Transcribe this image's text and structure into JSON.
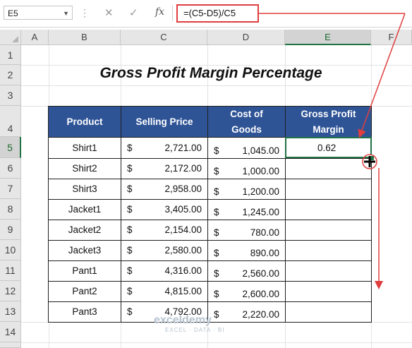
{
  "namebox": {
    "value": "E5"
  },
  "formula_bar": {
    "cancel_icon": "✕",
    "enter_icon": "✓",
    "fx_label": "fx",
    "formula": "=(C5-D5)/C5"
  },
  "columns": [
    "A",
    "B",
    "C",
    "D",
    "E",
    "F"
  ],
  "rows": [
    "1",
    "2",
    "3",
    "4",
    "5",
    "6",
    "7",
    "8",
    "9",
    "10",
    "11",
    "12",
    "13",
    "14"
  ],
  "title": "Gross Profit Margin Percentage",
  "table": {
    "headers": [
      "Product",
      "Selling Price",
      "Cost of Goods",
      "Gross Profit Margin"
    ],
    "rows": [
      {
        "product": "Shirt1",
        "sp_cur": "$",
        "sp": "2,721.00",
        "cg_cur": "$",
        "cg": "1,045.00",
        "gpm": "0.62"
      },
      {
        "product": "Shirt2",
        "sp_cur": "$",
        "sp": "2,172.00",
        "cg_cur": "$",
        "cg": "1,000.00",
        "gpm": ""
      },
      {
        "product": "Shirt3",
        "sp_cur": "$",
        "sp": "2,958.00",
        "cg_cur": "$",
        "cg": "1,200.00",
        "gpm": ""
      },
      {
        "product": "Jacket1",
        "sp_cur": "$",
        "sp": "3,405.00",
        "cg_cur": "$",
        "cg": "1,245.00",
        "gpm": ""
      },
      {
        "product": "Jacket2",
        "sp_cur": "$",
        "sp": "2,154.00",
        "cg_cur": "$",
        "cg": "780.00",
        "gpm": ""
      },
      {
        "product": "Jacket3",
        "sp_cur": "$",
        "sp": "2,580.00",
        "cg_cur": "$",
        "cg": "890.00",
        "gpm": ""
      },
      {
        "product": "Pant1",
        "sp_cur": "$",
        "sp": "4,316.00",
        "cg_cur": "$",
        "cg": "2,560.00",
        "gpm": ""
      },
      {
        "product": "Pant2",
        "sp_cur": "$",
        "sp": "4,815.00",
        "cg_cur": "$",
        "cg": "2,600.00",
        "gpm": ""
      },
      {
        "product": "Pant3",
        "sp_cur": "$",
        "sp": "4,792.00",
        "cg_cur": "$",
        "cg": "2,220.00",
        "gpm": ""
      }
    ]
  },
  "watermark": {
    "name": "exceldemy",
    "tagline": "EXCEL · DATA · BI"
  },
  "colors": {
    "header_fill": "#2f5496",
    "annotation": "#e03e3e",
    "excel_green": "#217346"
  },
  "icons": {
    "fill_handle": "plus-cursor-icon",
    "arrow": "arrow-down-icon"
  }
}
